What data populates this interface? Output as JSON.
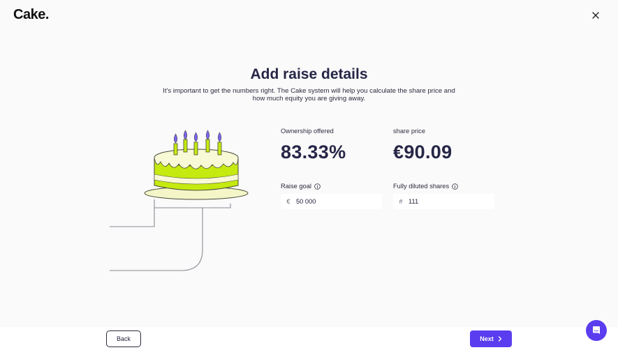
{
  "header": {
    "logo": "Cake."
  },
  "main": {
    "title": "Add raise details",
    "subtitle": "It's important to get the numbers right. The Cake system will help you calculate the share price and how much equity you are giving away."
  },
  "stats": {
    "ownership_label": "Ownership offered",
    "ownership_value": "83.33%",
    "share_price_label": "share price",
    "share_price_value": "€90.09"
  },
  "fields": {
    "raise_goal_label": "Raise goal",
    "raise_goal_prefix": "€",
    "raise_goal_value": "50 000",
    "shares_label": "Fully diluted shares",
    "shares_prefix": "#",
    "shares_value": "111"
  },
  "footer": {
    "back_label": "Back",
    "next_label": "Next"
  },
  "colors": {
    "accent": "#5b3df0",
    "cake_lime": "#c5ea10",
    "candle_flame": "#7b63f5"
  },
  "icons": {
    "close": "close-icon",
    "info": "info-icon",
    "next": "chevron-right-icon",
    "chat": "chat-icon"
  }
}
